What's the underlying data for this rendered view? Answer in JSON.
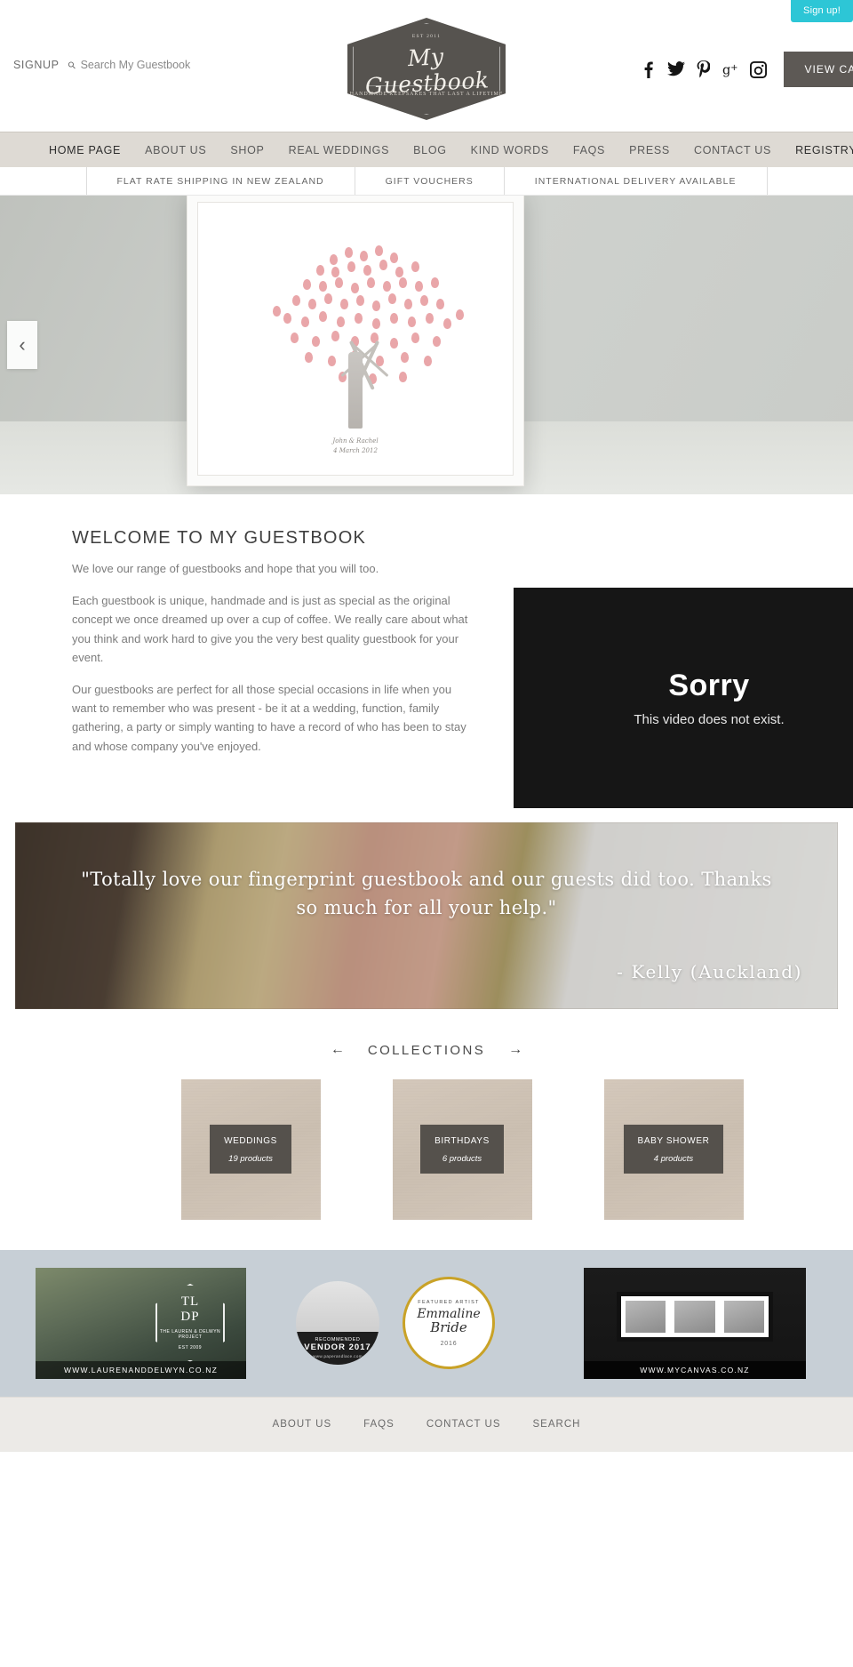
{
  "signup_tab": {
    "label": "Sign up!"
  },
  "header": {
    "signup_label": "SIGNUP",
    "search_placeholder": "Search My Guestbook",
    "search_value": "",
    "logo": {
      "est": "EST 2011",
      "name": "My Guestbook",
      "tagline": "HANDMADE KEEPSAKES THAT LAST A LIFETIME"
    },
    "socials": [
      {
        "name": "facebook-icon",
        "glyph": "f"
      },
      {
        "name": "twitter-icon",
        "glyph": "🐦"
      },
      {
        "name": "pinterest-icon",
        "glyph": "P"
      },
      {
        "name": "googleplus-icon",
        "glyph": "g+"
      },
      {
        "name": "instagram-icon",
        "glyph": "◉"
      }
    ],
    "cart_button": "VIEW CART"
  },
  "nav": {
    "items": [
      {
        "label": "HOME PAGE",
        "active": true
      },
      {
        "label": "ABOUT US",
        "active": false
      },
      {
        "label": "SHOP",
        "active": false
      },
      {
        "label": "REAL WEDDINGS",
        "active": false
      },
      {
        "label": "BLOG",
        "active": false
      },
      {
        "label": "KIND WORDS",
        "active": false
      },
      {
        "label": "FAQS",
        "active": false
      },
      {
        "label": "PRESS",
        "active": false
      },
      {
        "label": "CONTACT US",
        "active": false
      },
      {
        "label": "REGISTRY",
        "active": false
      }
    ]
  },
  "shipping_strip": {
    "items": [
      "FLAT RATE SHIPPING IN NEW ZEALAND",
      "GIFT VOUCHERS",
      "INTERNATIONAL DELIVERY AVAILABLE"
    ]
  },
  "hero": {
    "prev_arrow": "‹",
    "artwork_signature_line1": "John & Rachel",
    "artwork_signature_line2": "4 March 2012"
  },
  "welcome": {
    "heading": "WELCOME TO MY GUESTBOOK",
    "p1": "We love our range of guestbooks and hope that you will too.",
    "p2": "Each guestbook is unique, handmade and is just as special as the original concept we once dreamed up over a cup of coffee. We really care about what you think and work hard to give you the very best quality guestbook for your event.",
    "p3": "Our guestbooks are perfect for all those special occasions in life when you want to remember who was present - be it at a wedding, function, family gathering, a party or simply wanting to have a record of who has been to stay and whose company you've enjoyed."
  },
  "video": {
    "title": "Sorry",
    "message": "This video does not exist."
  },
  "testimonial": {
    "quote": "\"Totally love our fingerprint guestbook and our guests did too. Thanks so much for all your help.\"",
    "author": "- Kelly (Auckland)"
  },
  "collections": {
    "title": "COLLECTIONS",
    "prev_arrow": "←",
    "next_arrow": "→",
    "cards": [
      {
        "name": "WEDDINGS",
        "count": "19 products"
      },
      {
        "name": "BIRTHDAYS",
        "count": "6 products"
      },
      {
        "name": "BABY SHOWER",
        "count": "4 products"
      }
    ]
  },
  "logo_strip": {
    "badge1": {
      "initials_top": "TL",
      "initials_bottom": "DP",
      "sub": "THE LAUREN & DELWYN PROJECT",
      "est": "EST 2009",
      "url": "WWW.LAURENANDDELWYN.CO.NZ"
    },
    "badge2": {
      "line1": "RECOMMENDED",
      "line2": "VENDOR 2017",
      "line3": "www.paperandlace.com"
    },
    "badge3": {
      "line1": "FEATURED ARTIST",
      "line2": "Emmaline",
      "line3": "Bride",
      "line4": "2016"
    },
    "badge4": {
      "url": "WWW.MYCANVAS.CO.NZ"
    }
  },
  "footer": {
    "links": [
      "ABOUT US",
      "FAQS",
      "CONTACT US",
      "SEARCH"
    ]
  }
}
